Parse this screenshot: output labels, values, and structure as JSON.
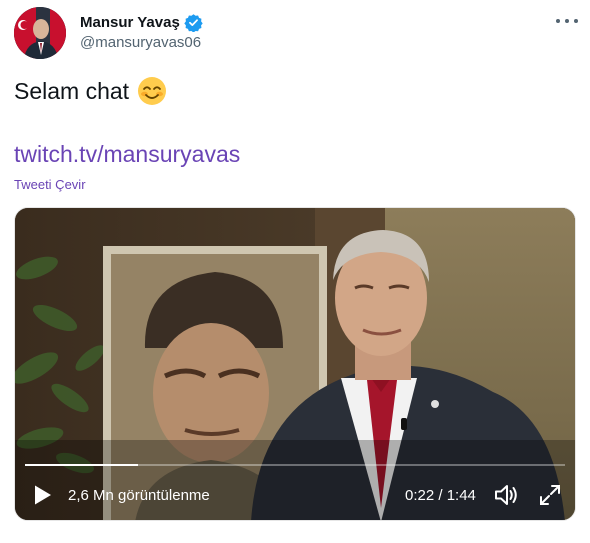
{
  "author": {
    "display_name": "Mansur Yavaş",
    "handle": "@mansuryavas06",
    "verified_icon": "verified-badge-icon",
    "avatar_icon": "profile-avatar"
  },
  "tweet": {
    "text": "Selam chat",
    "emoji": "smiling-face-with-smiling-eyes",
    "link": "twitch.tv/mansuryavas",
    "translate_label": "Tweeti Çevir"
  },
  "video": {
    "views": "2,6 Mn görüntülenme",
    "time": "0:22 / 1:44",
    "progress": 0.21,
    "icons": [
      "play-icon",
      "volume-icon",
      "fullscreen-icon"
    ]
  },
  "colors": {
    "link": "#6a44b5",
    "verified": "#1d9bf0",
    "secondary_text": "#536471"
  }
}
